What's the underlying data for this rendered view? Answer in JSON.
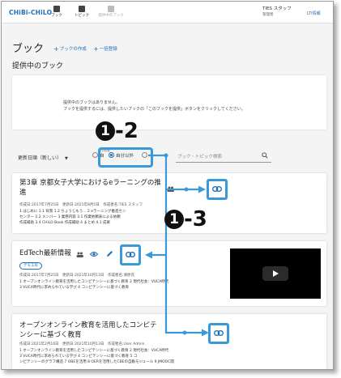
{
  "header": {
    "logo": "CHiBi-CHiLO",
    "nav": [
      {
        "label": "ブック"
      },
      {
        "label": "トピック"
      },
      {
        "label": "提供中のブック"
      }
    ],
    "user_name": "TIES スタッフ",
    "user_role": "管理者",
    "lti_label": "LTI情報"
  },
  "page": {
    "title": "ブック",
    "create_book": "ブックの作成",
    "bulk_register": "一括登録",
    "section_title": "提供中のブック"
  },
  "notice": {
    "line1": "提供中のブックはありません。",
    "line2": "ブックを提供するには、提供したいブックの「このブックを提供」ボタンをクリックしてください。"
  },
  "filter": {
    "sort_value": "更新日順（新しい",
    "radio_group_label": "作成者",
    "radio_all": "自",
    "radio_others": "自分以外",
    "search_placeholder": "ブック・トピック検索"
  },
  "cards": [
    {
      "title_line1": "第3章 京都女子大学におけるeラーニングの推",
      "title_line2": "進",
      "meta": "作成日:2017年7月25日　更新日:2021年8月5日　作成者名:TIES スタッフ",
      "desc_line1": "1 はじめに 1.1 背景 1.2 ちょうじもう... 2 eラーニング推進セン",
      "desc_line2": "センター 2.2 メンバー 3 業務内容 3.1 作業依頼表による依頼",
      "desc_line3": "作成補助 3.4 CHiLO Book 作成補助 4 まとめ 4.1 成果"
    },
    {
      "title": "EdTech最新情報",
      "tag": "デモ工房",
      "meta": "作成日:2017年7月25日　更新日:2021年10月13日　作成者名:清原氏",
      "desc_line1": "1 オープンオンライン教育を活用したコンピテンシーに基づく教育 2 現代社会：VUCA時代",
      "desc_line2": "3 VUCA時代に求められている学び 4 コンピテンシーに基づく教育"
    },
    {
      "title_line1": "オープンオンライン教育を活用したコンピテ",
      "title_line2": "ンシーに基づく教育",
      "meta": "作成日:2021年2月16日　更新日:2021年10月13日　作成者名:User Admin",
      "desc_line1": "1 オープンオンライン教育を活用したコンピテンシーに基づく教育 2 現代社会：VUCA時代",
      "desc_line2": "3 VUCA時代に求められている学び 4 コンピテンシーに基づく教育 5 コ",
      "desc_line3": "ンピテンシーのグラフ構造 7 OBEを活用 8 OERを活用したCBEの自動モジュール 9 JMOOC開"
    }
  ],
  "callouts": {
    "first_num": "1",
    "first_suffix": "-2",
    "second_num": "1",
    "second_suffix": "-3"
  },
  "colors": {
    "accent": "#1d6fb8",
    "highlight": "#3a9ad9"
  }
}
